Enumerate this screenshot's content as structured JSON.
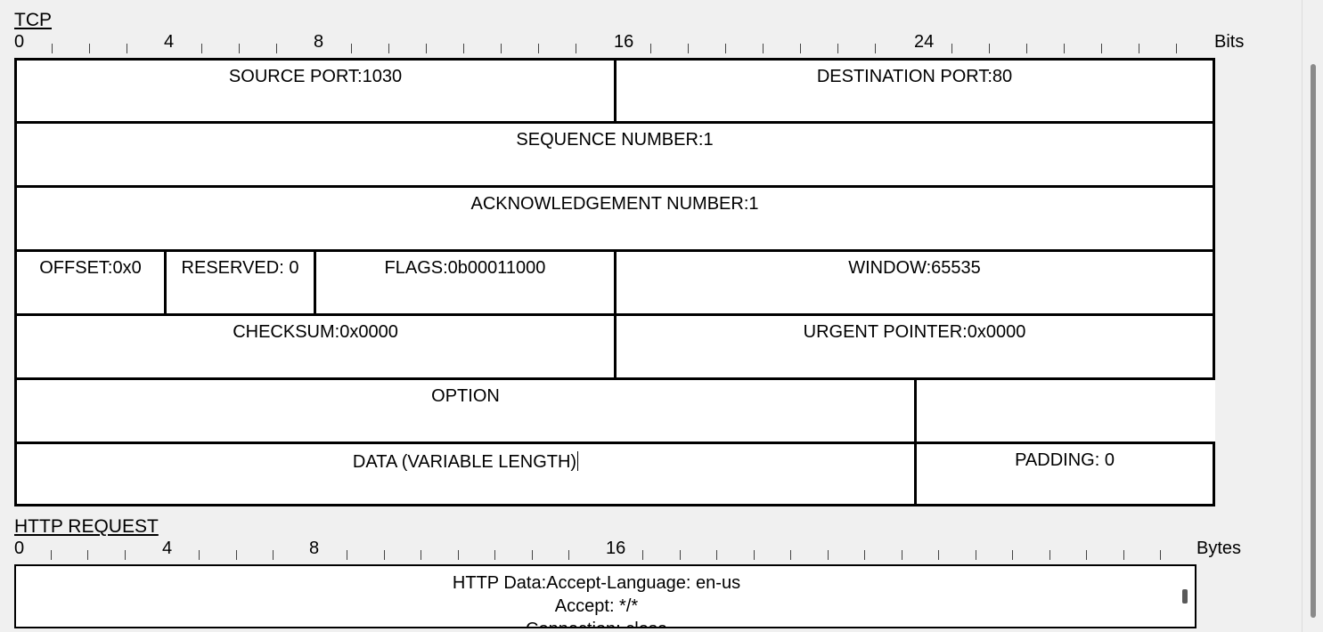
{
  "tcp": {
    "title": "TCP",
    "ruler": {
      "labels": [
        "0",
        "4",
        "8",
        "16",
        "24"
      ],
      "unit": "Bits"
    },
    "fields": {
      "source_port": "SOURCE PORT:1030",
      "destination_port": "DESTINATION PORT:80",
      "sequence_number": "SEQUENCE NUMBER:1",
      "acknowledgement_number": "ACKNOWLEDGEMENT NUMBER:1",
      "offset": "OFFSET:0x0",
      "reserved": "RESERVED: 0",
      "flags": "FLAGS:0b00011000",
      "window": "WINDOW:65535",
      "checksum": "CHECKSUM:0x0000",
      "urgent_pointer": "URGENT POINTER:0x0000",
      "option": "OPTION",
      "data": "DATA (VARIABLE LENGTH)",
      "padding": "PADDING: 0"
    }
  },
  "http": {
    "title": "HTTP REQUEST",
    "ruler": {
      "labels": [
        "0",
        "4",
        "8",
        "16"
      ],
      "unit": "Bytes"
    },
    "data_lines": [
      "HTTP Data:Accept-Language: en-us",
      "Accept: */*",
      "Connection: close"
    ]
  }
}
